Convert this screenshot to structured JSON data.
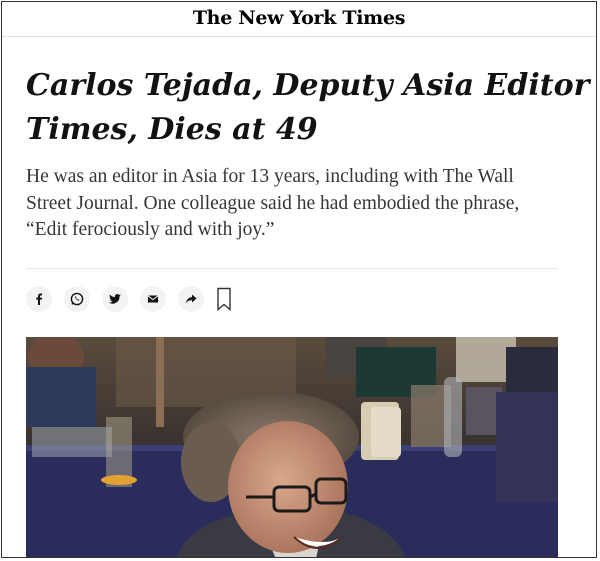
{
  "masthead": {
    "logo_text": "The New York Times"
  },
  "article": {
    "headline_lines": [
      "Carlos Tejada, Deputy Asia Editor for The",
      "Times, Dies at 49"
    ],
    "summary_lines": [
      "He was an editor in Asia for 13 years, including with The Wall",
      "Street Journal. One colleague said he had embodied the phrase,",
      "“Edit ferociously and with joy.”"
    ]
  },
  "share_tools": [
    {
      "name": "facebook",
      "icon": "facebook-icon"
    },
    {
      "name": "whatsapp",
      "icon": "whatsapp-icon"
    },
    {
      "name": "twitter",
      "icon": "twitter-icon"
    },
    {
      "name": "email",
      "icon": "email-icon"
    },
    {
      "name": "share",
      "icon": "share-arrow-icon"
    },
    {
      "name": "save",
      "icon": "bookmark-icon"
    }
  ],
  "colors": {
    "text": "#121212",
    "summary": "#363636",
    "icon_bg": "#f3f3f3",
    "tablecloth": "#2a2d5c"
  }
}
